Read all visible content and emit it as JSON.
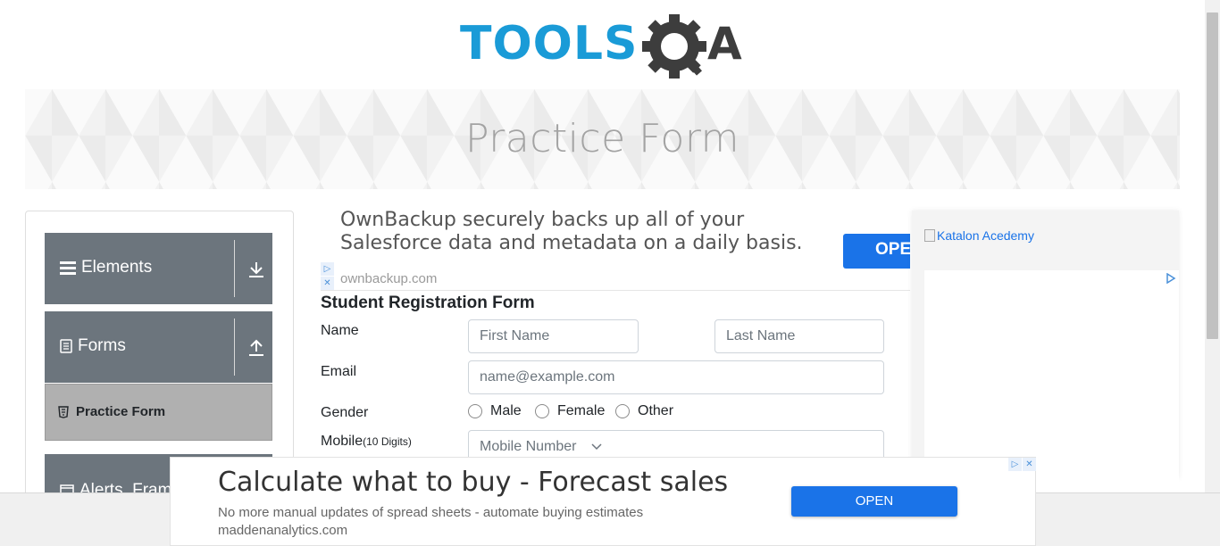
{
  "logo": {
    "text_left": "TOOLS",
    "text_right": "A",
    "colors": {
      "blue": "#1a9bd7",
      "dark": "#3d3d3d"
    }
  },
  "banner": {
    "title": "Practice Form"
  },
  "sidebar": {
    "groups": [
      {
        "label": "Elements",
        "icon": "hamburger-icon",
        "arrow": "download-arrow-icon"
      },
      {
        "label": "Forms",
        "icon": "document-icon",
        "arrow": "upload-arrow-icon"
      },
      {
        "label": "Alerts, Fram",
        "icon": "window-icon"
      }
    ],
    "active_item": {
      "label": "Practice Form",
      "icon": "html5-icon"
    }
  },
  "ad_top": {
    "line1": "OwnBackup securely backs up all of your",
    "line2": "Salesforce data and metadata on a daily basis.",
    "button": "OPE",
    "domain": "ownbackup.com"
  },
  "form": {
    "title": "Student Registration Form",
    "name_label": "Name",
    "first_name_placeholder": "First Name",
    "last_name_placeholder": "Last Name",
    "email_label": "Email",
    "email_placeholder": "name@example.com",
    "gender_label": "Gender",
    "gender_options": [
      "Male",
      "Female",
      "Other"
    ],
    "mobile_label": "Mobile",
    "mobile_hint": "(10 Digits)",
    "mobile_placeholder": "Mobile Number"
  },
  "ad_right": {
    "link_text": "Katalon Acedemy"
  },
  "ad_bottom": {
    "headline": "Calculate what to buy - Forecast sales",
    "subtext": "No more manual updates of spread sheets - automate buying estimates",
    "domain": "maddenanalytics.com",
    "button": "OPEN"
  }
}
